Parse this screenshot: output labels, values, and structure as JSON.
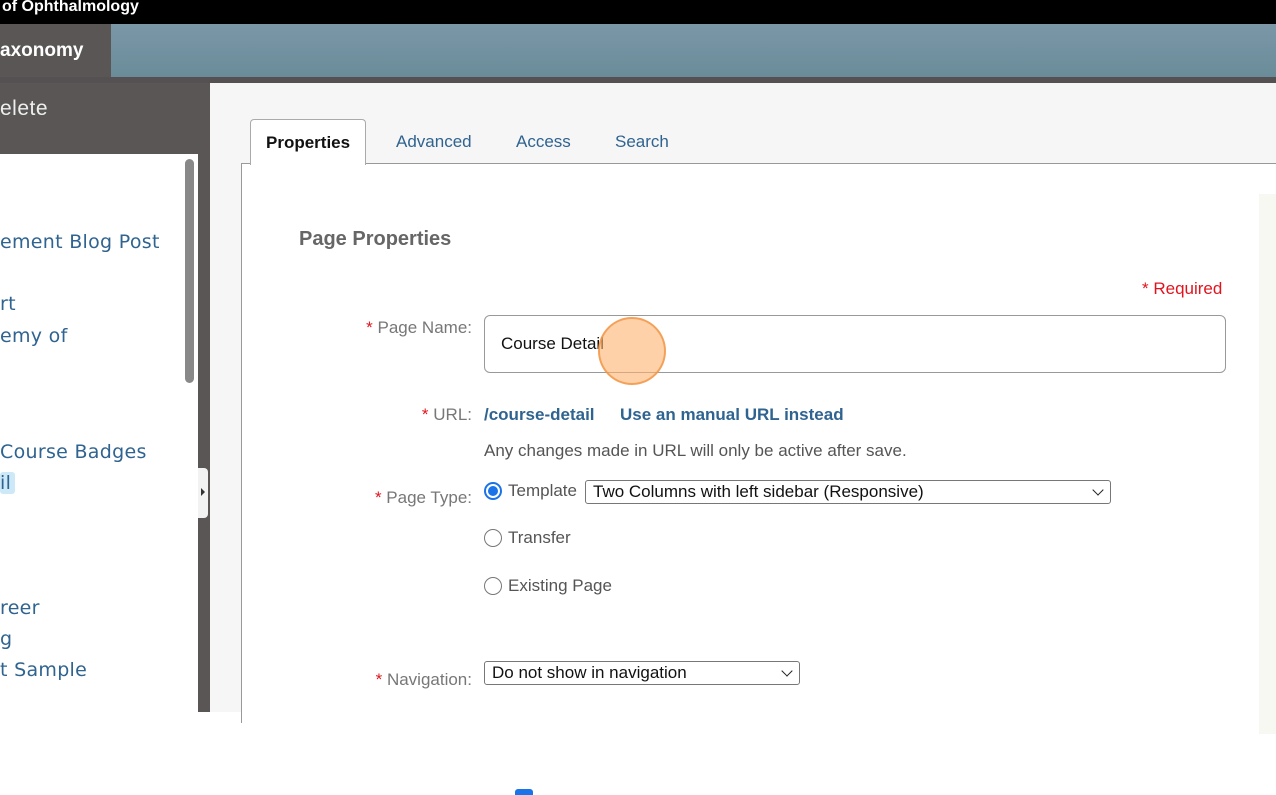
{
  "topbar": {
    "title": "of Ophthalmology"
  },
  "navbar": {
    "active_item": "axonomy"
  },
  "left_panel": {
    "header": "elete",
    "tree_items": [
      {
        "label": "ement Blog Post",
        "selected": false
      },
      {
        "label": "rt",
        "selected": false
      },
      {
        "label": "emy of",
        "selected": false
      },
      {
        "label": " Course Badges",
        "selected": false
      },
      {
        "label": "il",
        "selected": true
      },
      {
        "label": "reer",
        "selected": false
      },
      {
        "label": "g",
        "selected": false
      },
      {
        "label": "t Sample",
        "selected": false
      }
    ]
  },
  "tabs": [
    {
      "label": "Properties",
      "active": true
    },
    {
      "label": "Advanced",
      "active": false
    },
    {
      "label": "Access",
      "active": false
    },
    {
      "label": "Search",
      "active": false
    }
  ],
  "form": {
    "section_title": "Page Properties",
    "required_note": "* Required",
    "required_star": "*",
    "page_name": {
      "label": "Page Name:",
      "value": "Course Detail"
    },
    "url": {
      "label": "URL:",
      "value": "/course-detail",
      "manual_link": "Use an manual URL instead",
      "hint": "Any changes made in URL will only be active after save."
    },
    "page_type": {
      "label": "Page Type:",
      "options": [
        {
          "label": "Template",
          "checked": true
        },
        {
          "label": "Transfer",
          "checked": false
        },
        {
          "label": "Existing Page",
          "checked": false
        }
      ],
      "template_select": "Two Columns with left sidebar (Responsive)"
    },
    "navigation": {
      "label": "Navigation:",
      "value": "Do not show in navigation"
    }
  },
  "colors": {
    "link": "#2f6390",
    "required": "#e0141e",
    "radio_accent": "#1a73e8"
  }
}
